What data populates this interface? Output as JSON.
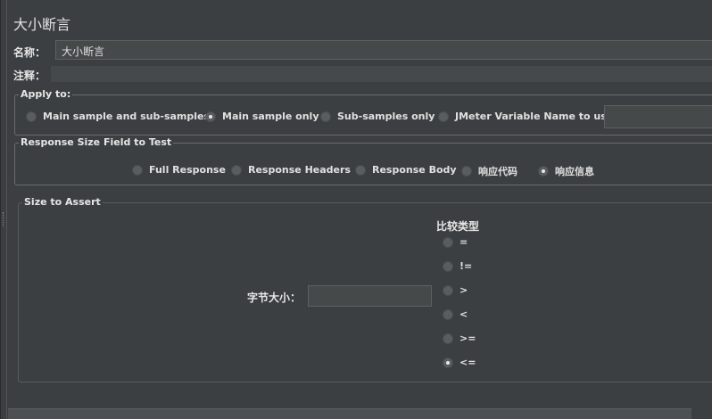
{
  "title": "大小断言",
  "name_row": {
    "label": "名称：",
    "value": "大小断言"
  },
  "comment_row": {
    "label": "注释：",
    "value": ""
  },
  "apply_to": {
    "legend": "Apply to:",
    "options": [
      {
        "label": "Main sample and sub-samples",
        "selected": false
      },
      {
        "label": "Main sample only",
        "selected": true
      },
      {
        "label": "Sub-samples only",
        "selected": false
      },
      {
        "label": "JMeter Variable Name to use",
        "selected": false
      }
    ],
    "variable_value": ""
  },
  "response_field": {
    "legend": "Response Size Field to Test",
    "options": [
      {
        "label": "Full Response",
        "selected": false
      },
      {
        "label": "Response Headers",
        "selected": false
      },
      {
        "label": "Response Body",
        "selected": false
      },
      {
        "label": "响应代码",
        "selected": false
      },
      {
        "label": "响应信息",
        "selected": true
      }
    ]
  },
  "size_to_assert": {
    "legend": "Size to Assert",
    "size_label": "字节大小：",
    "size_value": "",
    "compare_title": "比较类型",
    "operators": [
      {
        "label": "=",
        "selected": false
      },
      {
        "label": "!=",
        "selected": false
      },
      {
        "label": ">",
        "selected": false
      },
      {
        "label": "<",
        "selected": false
      },
      {
        "label": ">=",
        "selected": false
      },
      {
        "label": "<=",
        "selected": true
      }
    ]
  }
}
